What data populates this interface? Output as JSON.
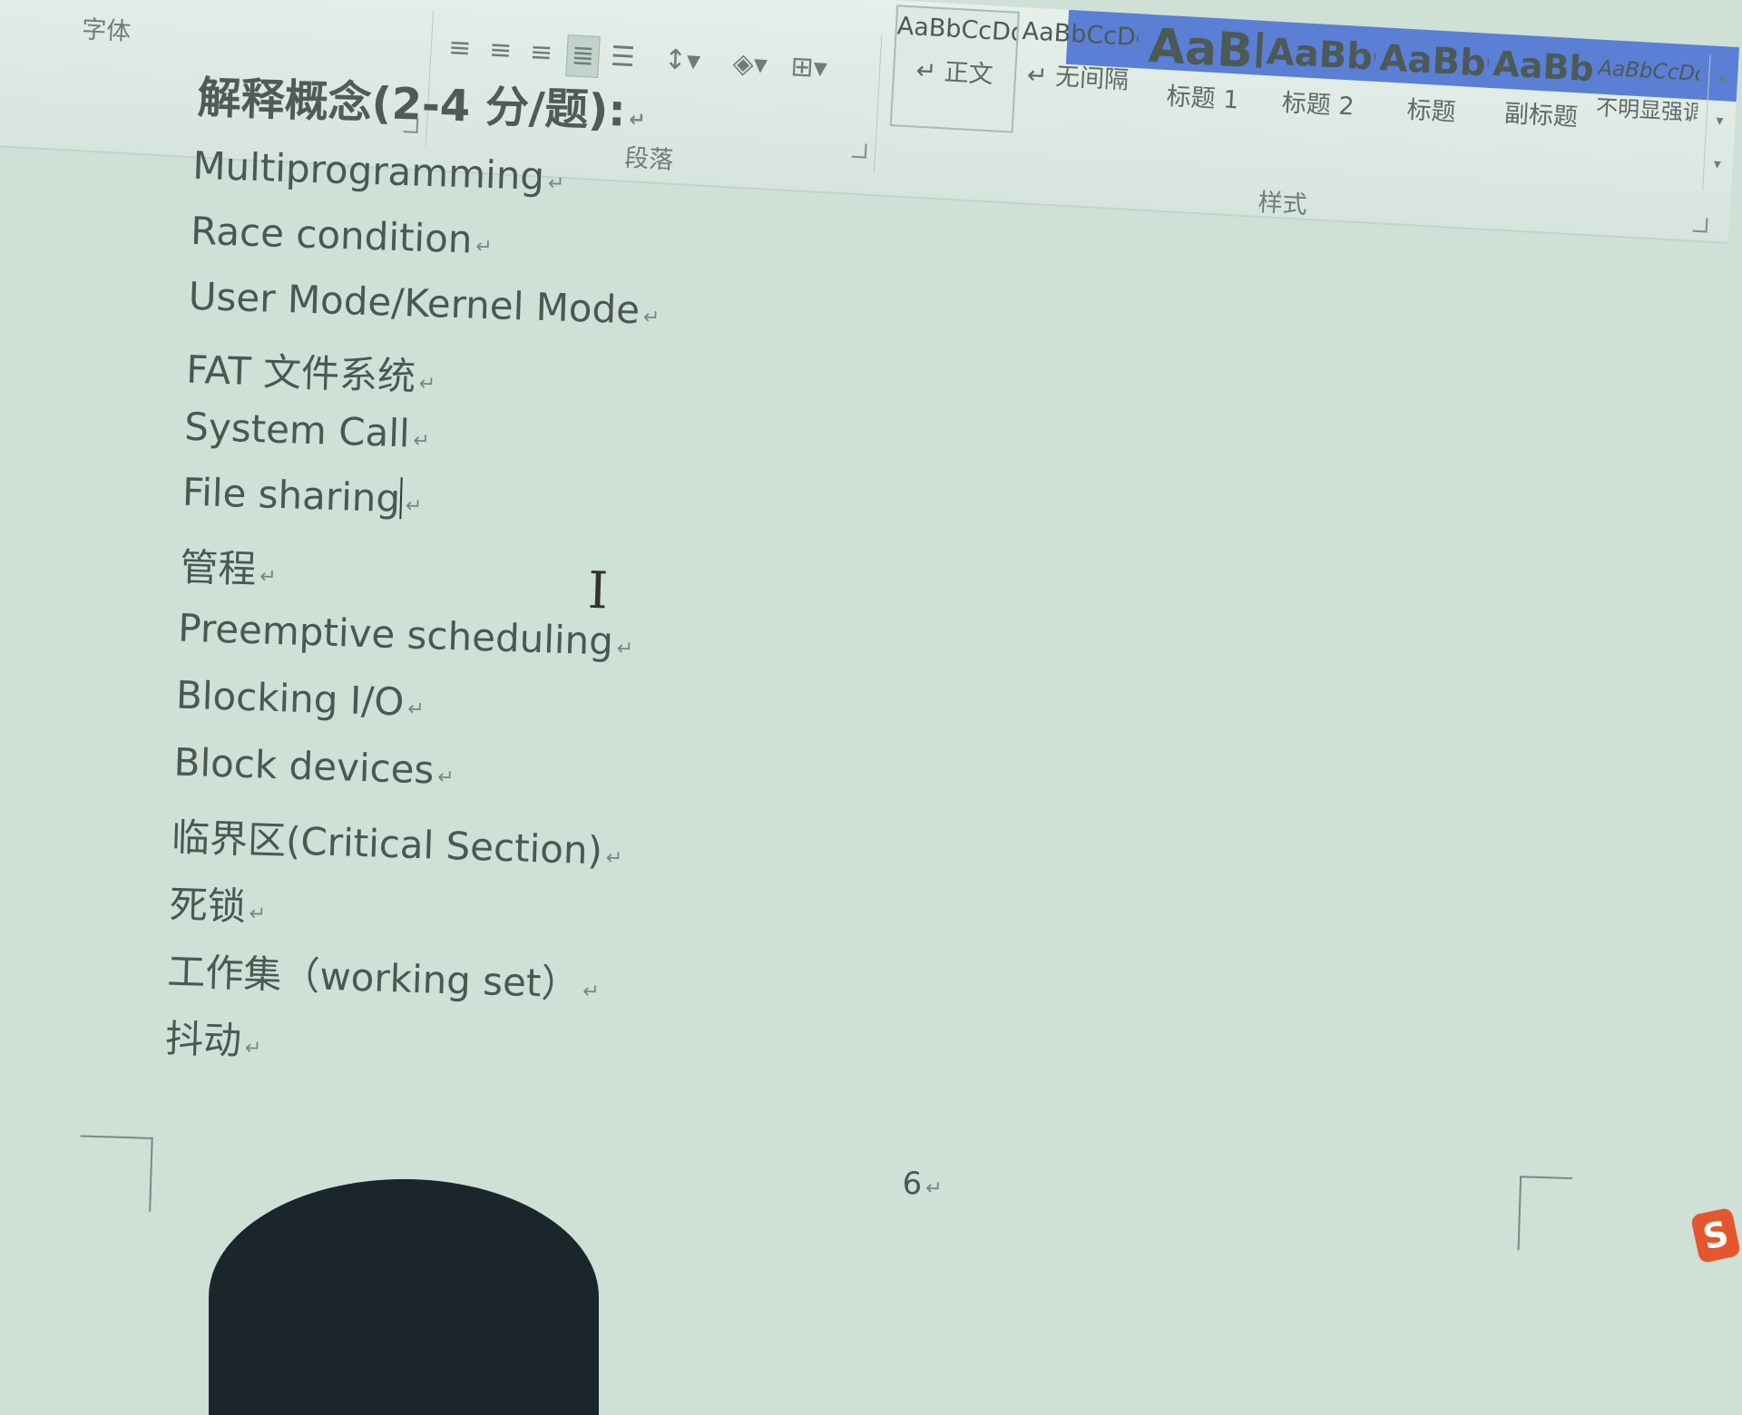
{
  "ribbon": {
    "font_group_label": "字体",
    "paragraph_group_label": "段落",
    "styles_group_label": "样式",
    "styles": [
      {
        "sample": "AaBbCcDdI",
        "name": "↵ 正文"
      },
      {
        "sample": "AaBbCcDdI",
        "name": "↵ 无间隔"
      },
      {
        "sample": "AaBb",
        "name": "标题 1"
      },
      {
        "sample": "AaBbC",
        "name": "标题 2"
      },
      {
        "sample": "AaBbC",
        "name": "标题"
      },
      {
        "sample": "AaBbC",
        "name": "副标题"
      },
      {
        "sample": "AaBbCcDd",
        "name": "不明显强调"
      }
    ],
    "icons": [
      "align-left-icon",
      "align-center-icon",
      "align-right-icon",
      "justify-icon",
      "distributed-icon",
      "line-spacing-icon",
      "shading-icon",
      "borders-icon"
    ]
  },
  "document": {
    "heading": "解释概念(2-4 分/题):",
    "terms": [
      "Multiprogramming",
      "Race condition",
      "User Mode/Kernel Mode",
      "FAT 文件系统",
      "System Call",
      "File sharing",
      "管程",
      "Preemptive scheduling",
      "Blocking I/O",
      "Block devices",
      "临界区(Critical Section)",
      "死锁",
      "工作集（working set）",
      "抖动"
    ],
    "paragraph_mark": "↵",
    "page_number": "6"
  },
  "ime": {
    "label": "S"
  },
  "colors": {
    "background": "#cfe0d6",
    "title_bar": "#5a7fd4",
    "ime": "#e4572e"
  }
}
